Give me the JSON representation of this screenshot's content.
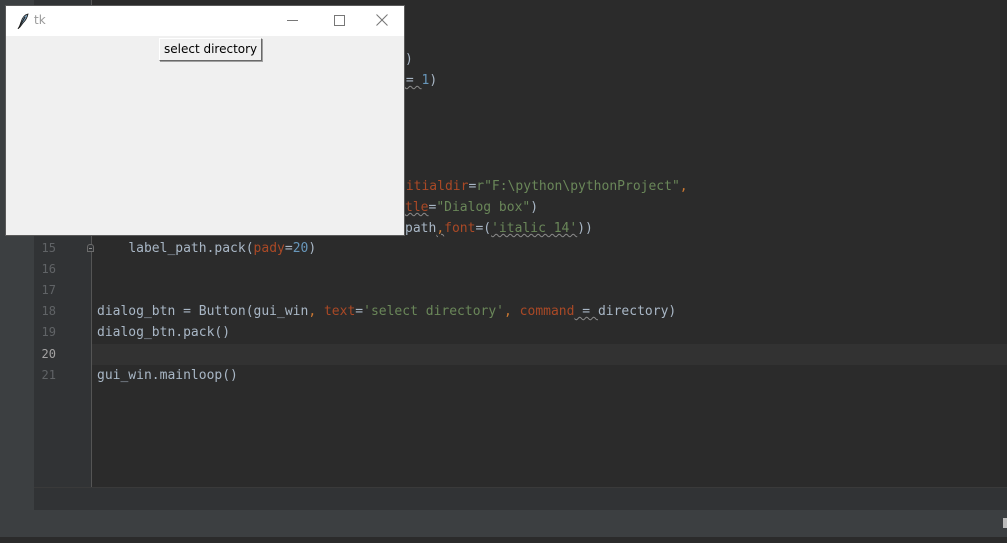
{
  "tk_window": {
    "title": "tk",
    "app_icon": "feather-icon",
    "controls": {
      "minimize": "minimize-icon",
      "maximize": "maximize-icon",
      "close": "close-icon"
    },
    "button_label": "select directory"
  },
  "editor": {
    "partial_lines": [
      {
        "line": "fragment-a",
        "tail": ")"
      },
      {
        "line": "fragment-b",
        "pre": " = ",
        "num": "1",
        "post": ")"
      },
      {
        "line": "fragment-c",
        "param": "nitialdir",
        "eq": "=",
        "str": "r\"F:\\python\\pythonProject\"",
        "comma": ","
      },
      {
        "line": "fragment-d",
        "param": "tle",
        "eq": "=",
        "str": "\"Dialog box\"",
        "post": ")"
      },
      {
        "line": "fragment-e",
        "pre": "path",
        "comma": ",",
        "param": "font",
        "eq": "=(",
        "str": "'italic 14'",
        "post": "))"
      }
    ],
    "lines": [
      {
        "number": "15",
        "indent": "    ",
        "code_plain": "label_path.pack(",
        "param": "pady",
        "eq": "=",
        "num": "20",
        "post": ")"
      },
      {
        "number": "16"
      },
      {
        "number": "17"
      },
      {
        "number": "18",
        "code_plain": "dialog_btn = Button(gui_win",
        "comma": ", ",
        "param1": "text",
        "eq1": "=",
        "str": "'select directory'",
        "comma2": ", ",
        "param2": "command",
        "eq2": " = ",
        "post": "directory)"
      },
      {
        "number": "19",
        "code_plain": "dialog_btn.pack()"
      },
      {
        "number": "20",
        "active": true
      },
      {
        "number": "21",
        "code_plain": "gui_win.mainloop()"
      }
    ]
  },
  "colors": {
    "editor_bg": "#2b2b2b",
    "gutter_bg": "#313335",
    "keyword_param": "#aa4926",
    "string": "#6a8759",
    "number": "#6897bb",
    "plain": "#a9b7c6"
  }
}
